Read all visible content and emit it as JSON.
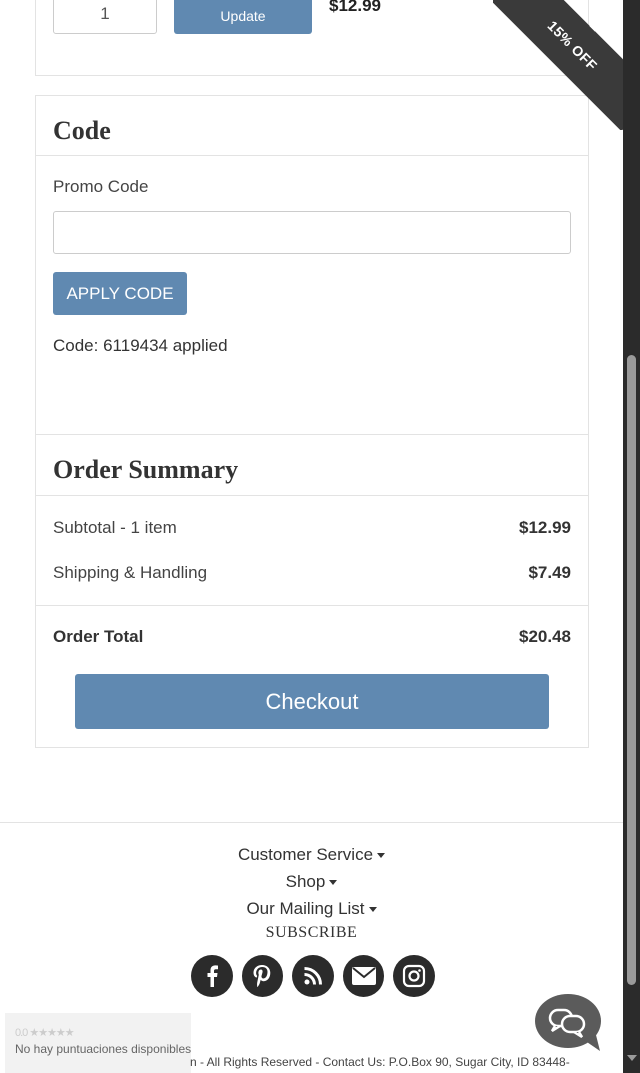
{
  "cart": {
    "quantity": "1",
    "update_label": "Update",
    "item_price": "$12.99",
    "ribbon_label": "15% OFF"
  },
  "code_section": {
    "title": "Code",
    "promo_label": "Promo Code",
    "promo_value": "",
    "apply_label": "APPLY CODE",
    "applied_text": "Code: 6119434 applied"
  },
  "summary": {
    "title": "Order Summary",
    "subtotal_label": "Subtotal - 1 item",
    "subtotal_value": "$12.99",
    "shipping_label": "Shipping & Handling",
    "shipping_value": "$7.49",
    "total_label": "Order Total",
    "total_value": "$20.48",
    "checkout_label": "Checkout"
  },
  "footer": {
    "links": [
      "Customer Service",
      "Shop",
      "Our Mailing List"
    ],
    "subscribe_label": "SUBSCRIBE",
    "social_icons": [
      "facebook-icon",
      "pinterest-icon",
      "rss-icon",
      "email-icon",
      "instagram-icon"
    ],
    "rating_score": "0.0",
    "rating_text": "No hay puntuaciones disponibles",
    "copyright": "n - All Rights Reserved - Contact Us: P.O.Box 90, Sugar City, ID 83448-"
  },
  "colors": {
    "accent": "#6089b1",
    "ribbon": "#3a3a3a",
    "social_bg": "#2b2b2b"
  }
}
